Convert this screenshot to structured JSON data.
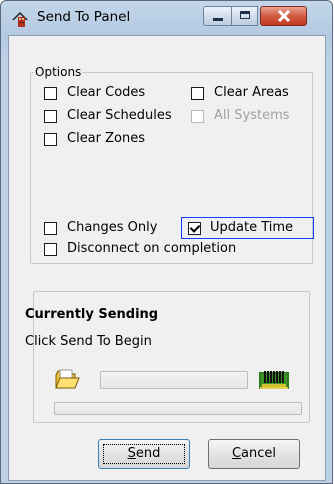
{
  "window": {
    "title": "Send To Panel"
  },
  "options": {
    "legend": "Options",
    "items": [
      {
        "label": "Clear Codes",
        "checked": false,
        "enabled": true
      },
      {
        "label": "Clear Areas",
        "checked": false,
        "enabled": true
      },
      {
        "label": "Clear Schedules",
        "checked": false,
        "enabled": true
      },
      {
        "label": "All Systems",
        "checked": false,
        "enabled": false
      },
      {
        "label": "Clear Zones",
        "checked": false,
        "enabled": true
      },
      {
        "label": "Changes Only",
        "checked": false,
        "enabled": true
      },
      {
        "label": "Update Time",
        "checked": true,
        "enabled": true
      },
      {
        "label": "Disconnect on completion",
        "checked": false,
        "enabled": true
      }
    ]
  },
  "status": {
    "heading": "Currently Sending",
    "message": "Click Send To Begin",
    "progress": 0,
    "overall_progress": 0
  },
  "buttons": {
    "send": {
      "label_pre": "",
      "label_accel": "S",
      "label_post": "end"
    },
    "cancel": {
      "label_pre": "",
      "label_accel": "C",
      "label_post": "ancel"
    }
  },
  "icons": {
    "app": "alarm-panel-icon",
    "folder": "open-folder-icon",
    "panel": "circuit-board-icon"
  }
}
